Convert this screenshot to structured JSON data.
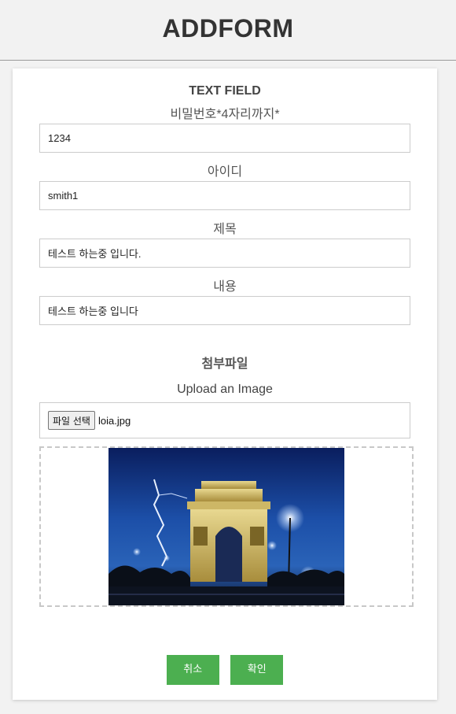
{
  "header": {
    "title": "ADDFORM"
  },
  "form": {
    "section_title": "TEXT FIELD",
    "fields": [
      {
        "label": "비밀번호*4자리까지*",
        "value": "1234"
      },
      {
        "label": "아이디",
        "value": "smith1"
      },
      {
        "label": "제목",
        "value": "테스트 하는중 입니다."
      },
      {
        "label": "내용",
        "value": "테스트 하는중 입니다"
      }
    ]
  },
  "attachment": {
    "title": "첨부파일",
    "upload_label": "Upload an Image",
    "choose_button": "파일 선택",
    "file_name": "loia.jpg",
    "preview_icon": "image-preview"
  },
  "actions": {
    "cancel_label": "취소",
    "confirm_label": "확인"
  },
  "colors": {
    "accent": "#4caf50",
    "page_bg": "#f2f2f2",
    "card_bg": "#ffffff"
  }
}
